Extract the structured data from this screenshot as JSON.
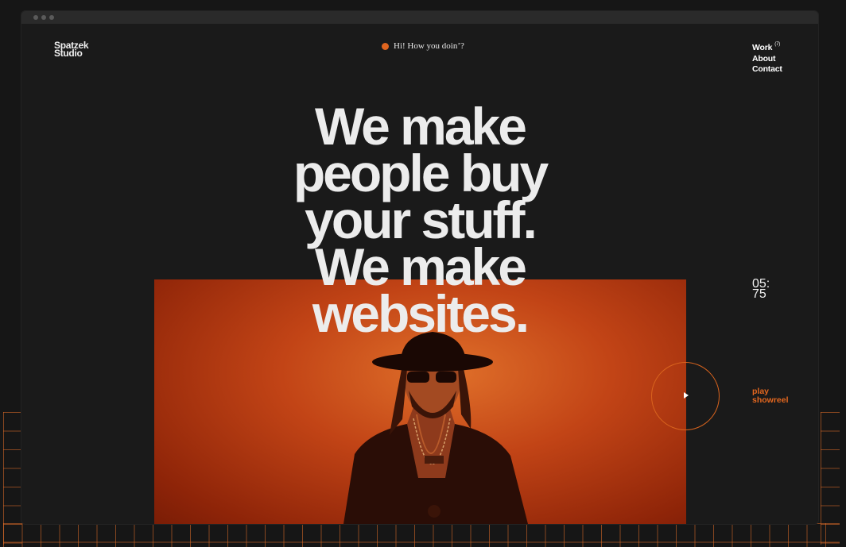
{
  "logo": {
    "line1": "Spatzek",
    "line2": "Studio"
  },
  "greeting": {
    "text": "Hi! How you doin’?"
  },
  "nav": {
    "items": [
      {
        "label": "Work",
        "badge": "(7)"
      },
      {
        "label": "About"
      },
      {
        "label": "Contact"
      }
    ]
  },
  "hero": {
    "lines": [
      "We make",
      "people buy",
      "your stuff.",
      "We make",
      "websites."
    ]
  },
  "counter": {
    "line1": "05:",
    "line2": "75"
  },
  "showreel": {
    "line1": "play",
    "line2": "showreel"
  },
  "colors": {
    "accent": "#e3671f",
    "background": "#161616",
    "hero_bg": "#c24416"
  }
}
